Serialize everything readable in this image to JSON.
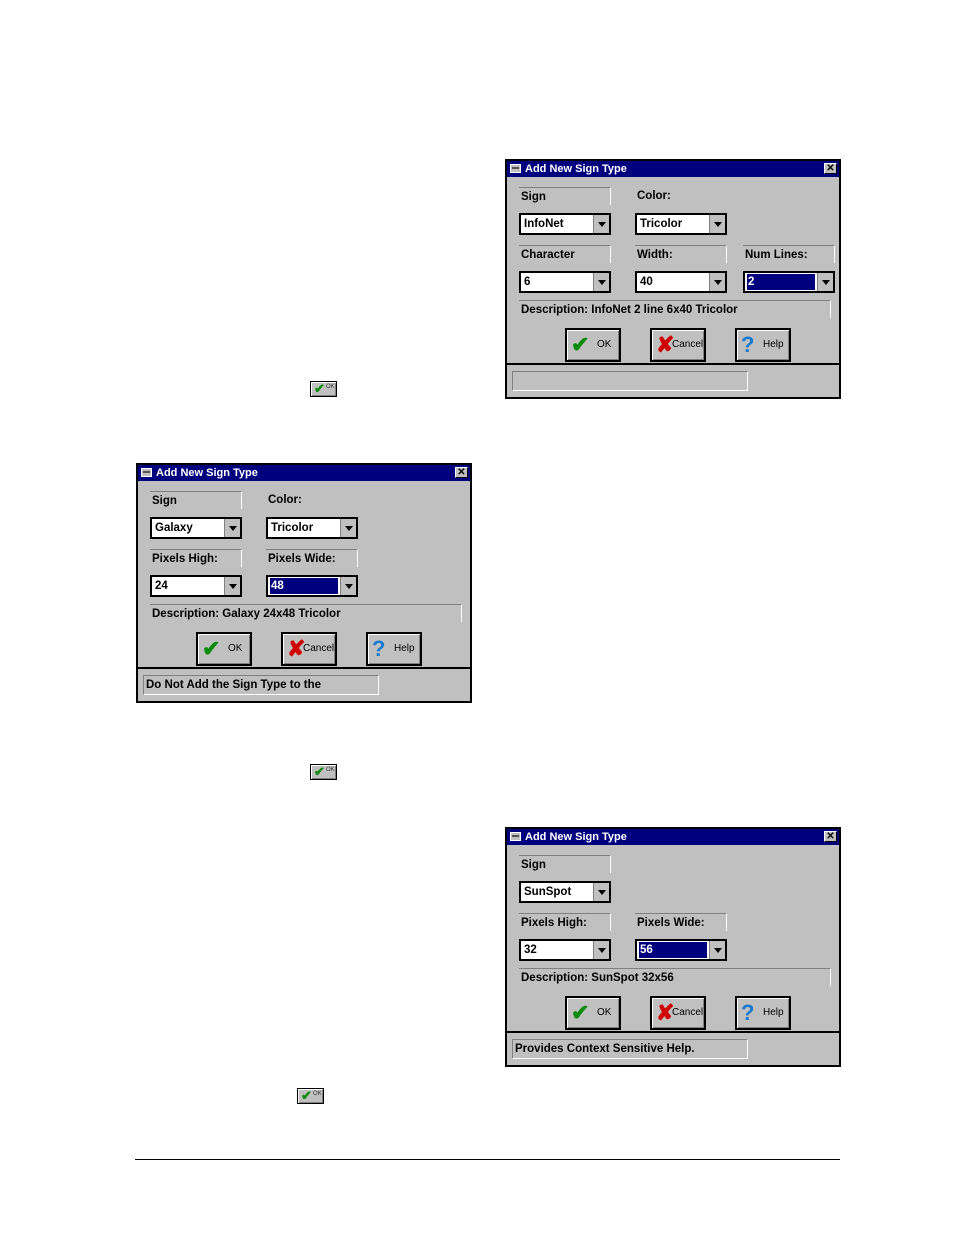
{
  "dialog_title": "Add New Sign Type",
  "buttons": {
    "ok": "OK",
    "cancel": "Cancel",
    "help": "Help"
  },
  "ok_icon_text": "OK",
  "dialog1": {
    "sign_label": "Sign",
    "sign_value": "InfoNet",
    "color_label": "Color:",
    "color_value": "Tricolor",
    "char_label": "Character",
    "char_value": "6",
    "width_label": "Width:",
    "width_value": "40",
    "lines_label": "Num Lines:",
    "lines_value": "2",
    "description": "Description: InfoNet 2 line 6x40 Tricolor",
    "status": ""
  },
  "dialog2": {
    "sign_label": "Sign",
    "sign_value": "Galaxy",
    "color_label": "Color:",
    "color_value": "Tricolor",
    "high_label": "Pixels High:",
    "high_value": "24",
    "wide_label": "Pixels Wide:",
    "wide_value": "48",
    "description": "Description: Galaxy 24x48 Tricolor",
    "status": "Do Not Add the Sign Type to the"
  },
  "dialog3": {
    "sign_label": "Sign",
    "sign_value": "SunSpot",
    "high_label": "Pixels High:",
    "high_value": "32",
    "wide_label": "Pixels Wide:",
    "wide_value": "56",
    "description": "Description: SunSpot 32x56",
    "status": "Provides Context Sensitive Help."
  },
  "icons": {
    "ok": "check-icon",
    "cancel": "x-icon",
    "help": "question-icon",
    "system_menu": "system-menu-icon",
    "close": "close-icon"
  },
  "colors": {
    "title_bar": "#00007f",
    "dialog_face": "#c0c0c0",
    "selection": "#00007f",
    "ok_check": "#0a8a0a",
    "cancel_x": "#d00000",
    "help_q": "#1a7ad0"
  }
}
